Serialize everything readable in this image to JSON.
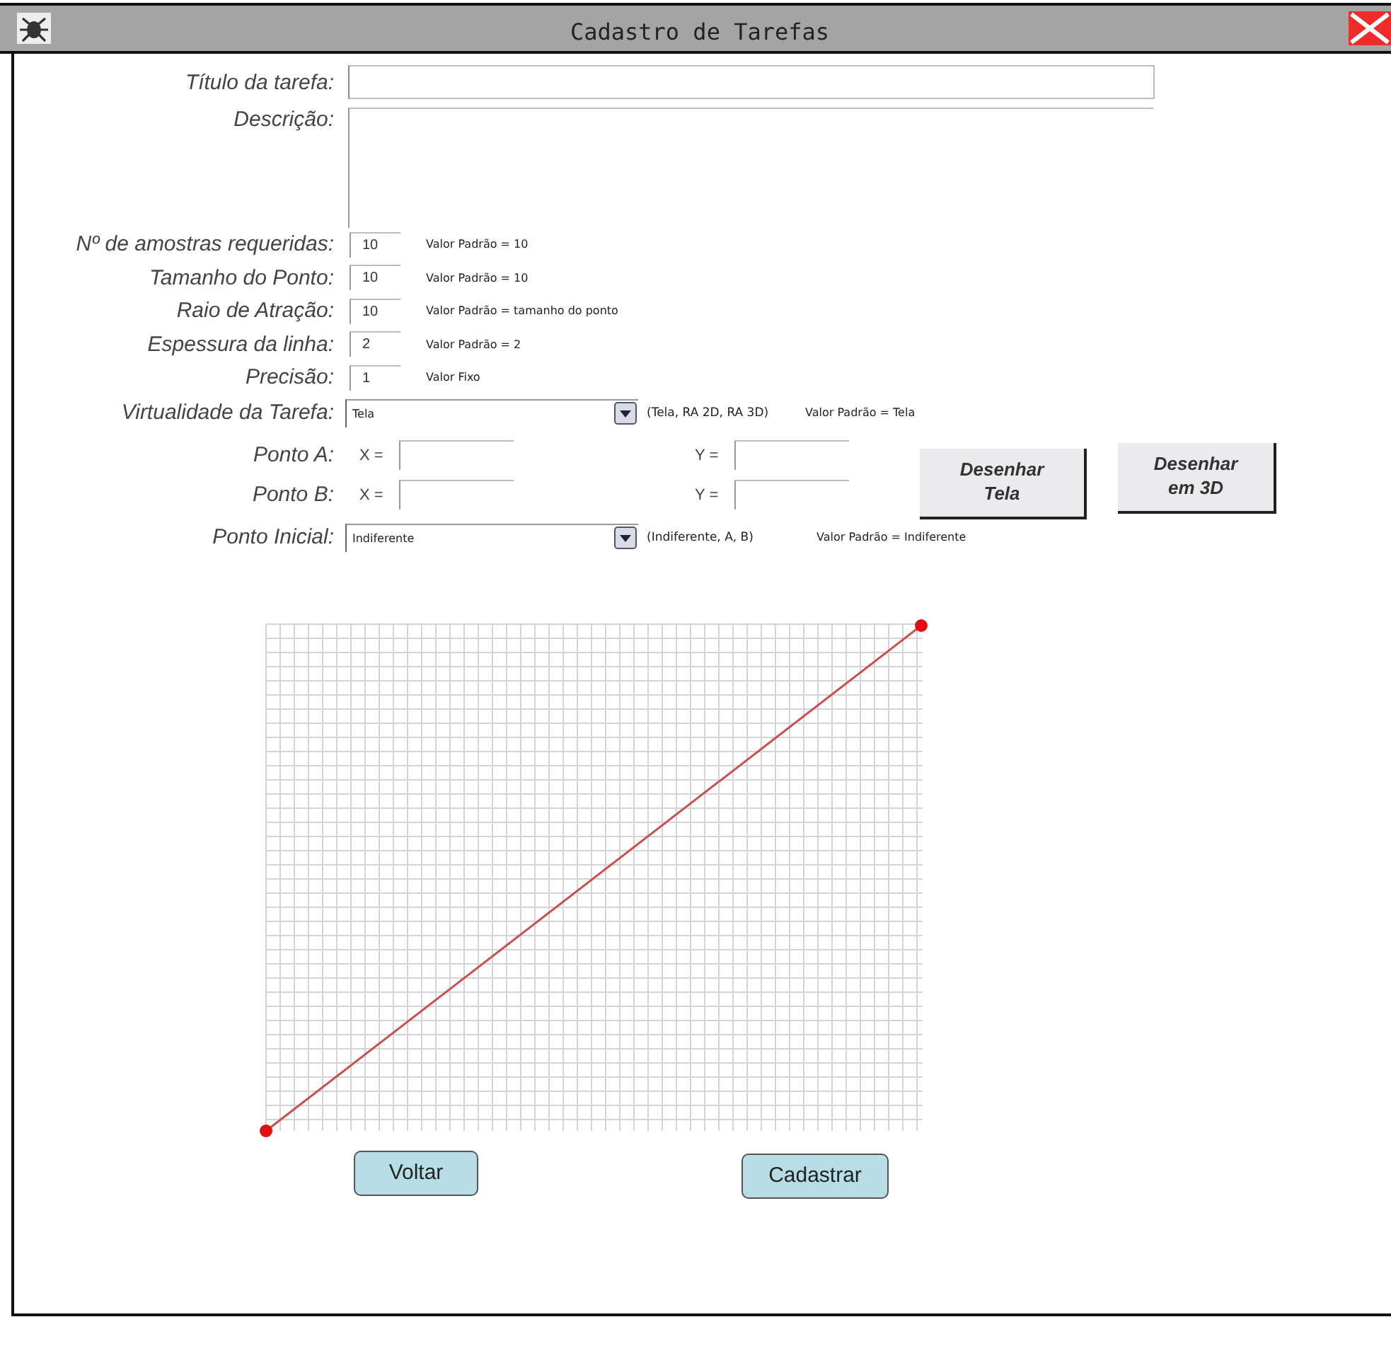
{
  "window": {
    "title": "Cadastro de Tarefas"
  },
  "form": {
    "title_field": {
      "label": "Título da tarefa:"
    },
    "description": {
      "label": "Descrição:"
    },
    "numeric_fields": [
      {
        "label": "Nº de amostras requeridas:",
        "value": "10",
        "note": "Valor Padrão = 10"
      },
      {
        "label": "Tamanho do Ponto:",
        "value": "10",
        "note": "Valor Padrão = 10"
      },
      {
        "label": "Raio de Atração:",
        "value": "10",
        "note": "Valor Padrão = tamanho do ponto"
      },
      {
        "label": "Espessura da linha:",
        "value": "2",
        "note": "Valor Padrão = 2"
      },
      {
        "label": "Precisão:",
        "value": "1",
        "note": "Valor Fixo"
      }
    ],
    "virtuality": {
      "label": "Virtualidade da Tarefa:",
      "value": "Tela",
      "options_note": "(Tela, RA 2D, RA 3D)",
      "note": "Valor Padrão = Tela"
    },
    "points": [
      {
        "label": "Ponto A:",
        "x_label": "X =",
        "y_label": "Y ="
      },
      {
        "label": "Ponto B:",
        "x_label": "X =",
        "y_label": "Y ="
      }
    ],
    "draw_buttons": [
      "Desenhar Tela",
      "Desenhar em 3D"
    ],
    "initial_point": {
      "label": "Ponto Inicial:",
      "value": "Indiferente",
      "options_note": "(Indiferente, A, B)",
      "note": "Valor Padrão = Indiferente"
    }
  },
  "buttons": [
    "Voltar",
    "Cadastrar"
  ]
}
